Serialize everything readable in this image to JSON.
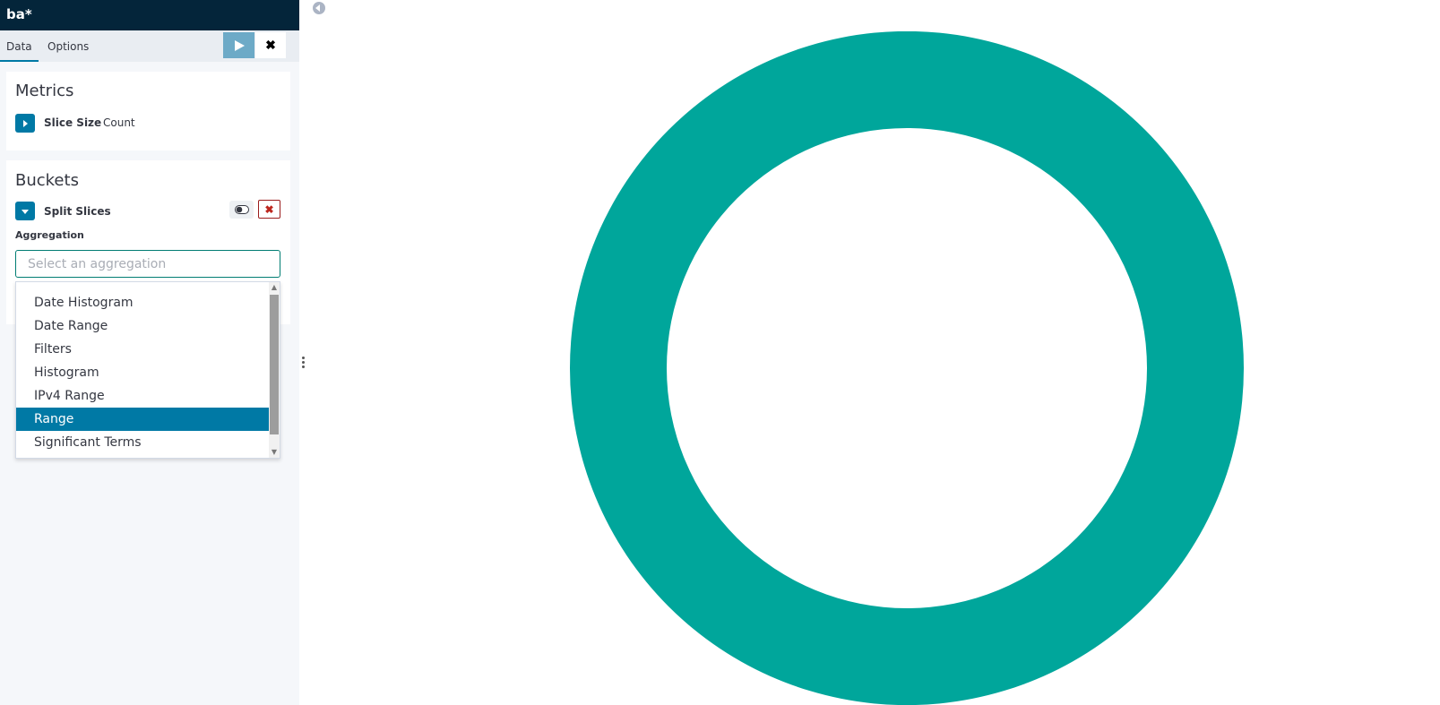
{
  "header": {
    "title": "ba*"
  },
  "tabs": [
    {
      "label": "Data",
      "active": true
    },
    {
      "label": "Options",
      "active": false
    }
  ],
  "toolbar": {
    "apply_icon": "play-icon",
    "discard_icon": "close-icon",
    "discard_label": "✖"
  },
  "metrics": {
    "title": "Metrics",
    "agg_label": "Slice Size",
    "agg_value": "Count",
    "toggle_icon": "caret-right-icon"
  },
  "buckets": {
    "title": "Buckets",
    "agg_label": "Split Slices",
    "toggle_icon": "caret-down-icon",
    "disable_icon": "toggle-icon",
    "remove_label": "✖",
    "field_label": "Aggregation",
    "input": {
      "placeholder": "Select an aggregation",
      "value": ""
    },
    "options": [
      {
        "label": "Date Histogram"
      },
      {
        "label": "Date Range"
      },
      {
        "label": "Filters"
      },
      {
        "label": "Histogram"
      },
      {
        "label": "IPv4 Range"
      },
      {
        "label": "Range",
        "selected": true
      },
      {
        "label": "Significant Terms"
      }
    ]
  },
  "visualization": {
    "type": "donut",
    "slices": [
      {
        "value": 1,
        "color": "#00a69b"
      }
    ]
  },
  "colors": {
    "accent": "#0079a5",
    "header_bg": "#04253a",
    "slice": "#00a69b"
  }
}
